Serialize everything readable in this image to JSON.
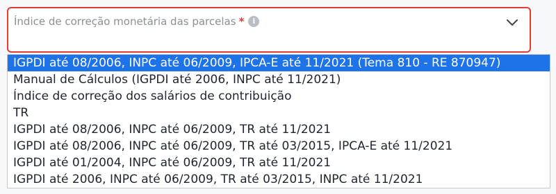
{
  "field": {
    "label": "Índice de correção monetária das parcelas",
    "required_mark": "*",
    "info_icon": "i",
    "chevron_icon": "chevron-down-icon"
  },
  "dropdown": {
    "options": [
      {
        "label": "IGPDI até 08/2006, INPC até 06/2009, IPCA-E até 11/2021 (Tema 810 - RE 870947)",
        "selected": true
      },
      {
        "label": "Manual de Cálculos (IGPDI até 2006, INPC até 11/2021)",
        "selected": false
      },
      {
        "label": "Índice de correção dos salários de contribuição",
        "selected": false
      },
      {
        "label": "TR",
        "selected": false
      },
      {
        "label": "IGPDI até 08/2006, INPC até 06/2009, TR até 11/2021",
        "selected": false
      },
      {
        "label": "IGPDI até 08/2006, INPC até 06/2009, TR até 03/2015, IPCA-E até 11/2021",
        "selected": false
      },
      {
        "label": "IGPDI até 01/2004, INPC até 06/2009, TR até 11/2021",
        "selected": false
      },
      {
        "label": "IGPDI até 2006, INPC até 06/2009, TR até 03/2015, INPC até 11/2021",
        "selected": false
      }
    ]
  },
  "colors": {
    "error_border": "#e53935",
    "selected_bg": "#1e73e8",
    "label_text": "#8a8f98"
  }
}
